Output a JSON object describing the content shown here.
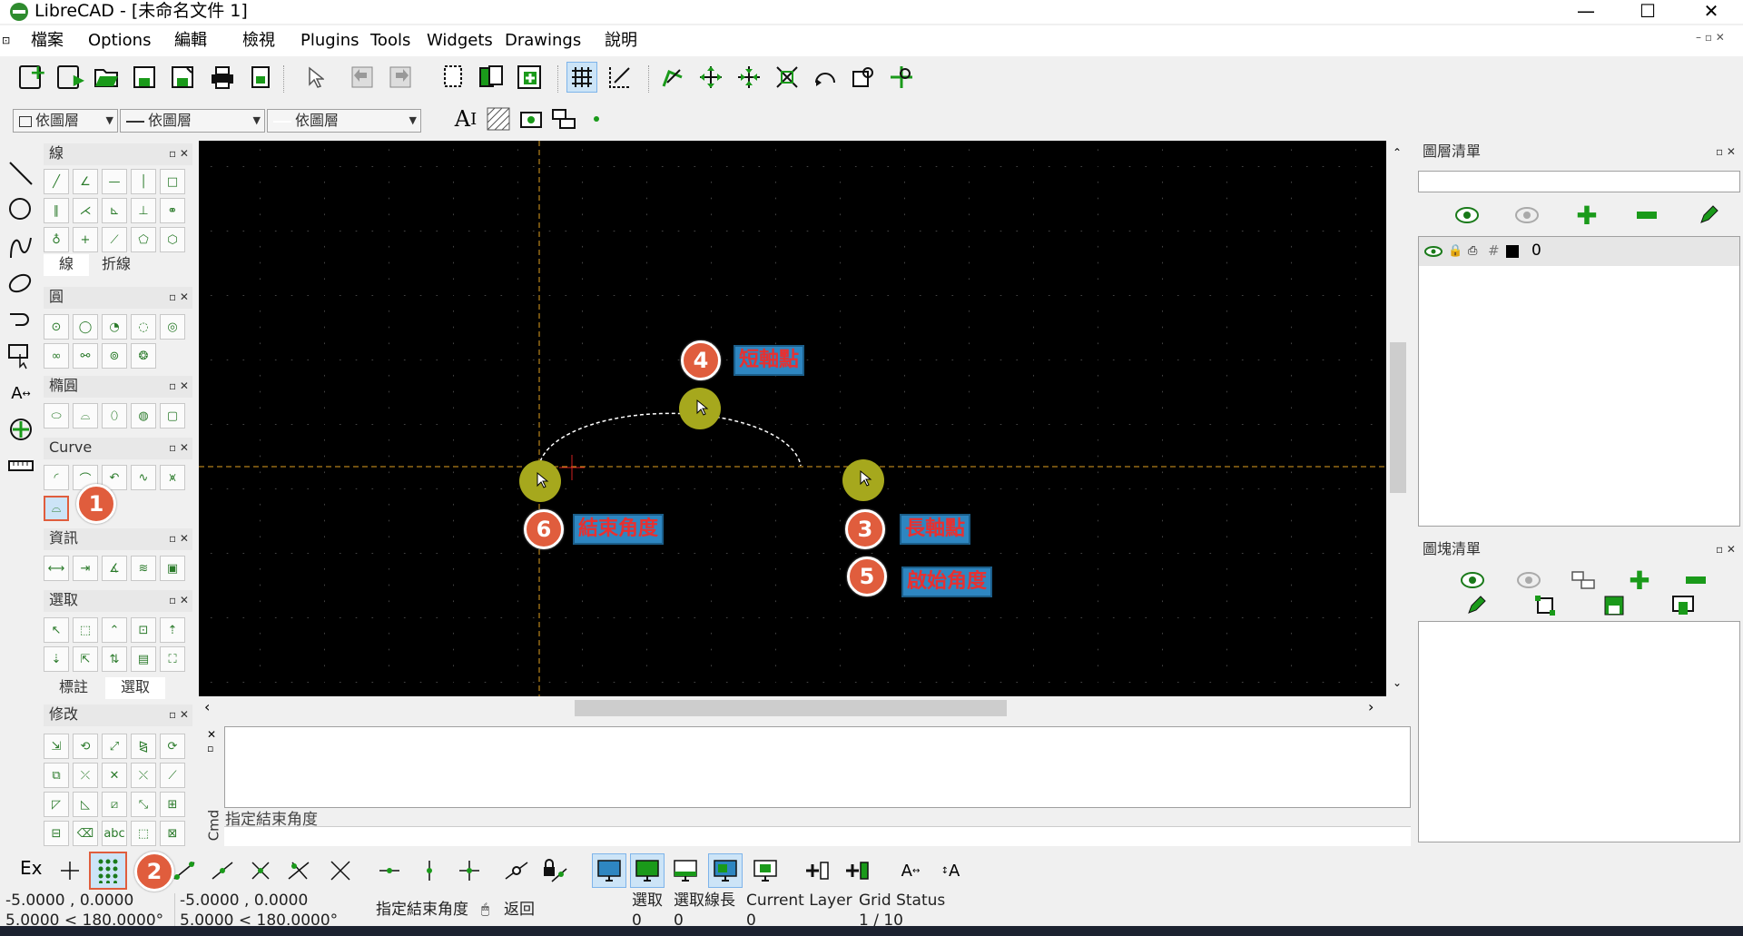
{
  "window": {
    "title": "LibreCAD - [未命名文件 1]",
    "minimize": "—",
    "maximize": "☐",
    "close": "✕"
  },
  "menu": [
    "檔案",
    "Options",
    "編輯",
    "檢視",
    "Plugins",
    "Tools",
    "Widgets",
    "Drawings",
    "說明"
  ],
  "layer_combos": [
    "依圖層",
    "依圖層",
    "依圖層"
  ],
  "docks": {
    "line": {
      "title": "線",
      "tabs": [
        "線",
        "折線"
      ]
    },
    "circle": {
      "title": "圓"
    },
    "ellipse": {
      "title": "橢圓"
    },
    "curve": {
      "title": "Curve"
    },
    "info": {
      "title": "資訊"
    },
    "select": {
      "title": "選取",
      "tabs": [
        "標註",
        "選取"
      ]
    },
    "modify": {
      "title": "修改"
    }
  },
  "layer_panel": {
    "title": "圖層清單",
    "search_placeholder": "",
    "layers": [
      {
        "name": "0",
        "color": "#000000"
      }
    ]
  },
  "block_panel": {
    "title": "圖塊清單"
  },
  "annotations": [
    {
      "n": "4",
      "label": "短軸點"
    },
    {
      "n": "3",
      "label": "長軸點"
    },
    {
      "n": "5",
      "label": "啟始角度"
    },
    {
      "n": "6",
      "label": "結束角度"
    },
    {
      "n": "1",
      "label": ""
    },
    {
      "n": "2",
      "label": ""
    }
  ],
  "command": {
    "side_label": "Cmd",
    "prompt": "指定結束角度"
  },
  "snap_bar": {
    "ex": "Ex"
  },
  "status": {
    "abs_coord": "-5.0000 , 0.0000",
    "abs_polar": "5.0000 < 180.0000°",
    "rel_coord": "-5.0000 , 0.0000",
    "rel_polar": "5.0000 < 180.0000°",
    "prompt": "指定結束角度",
    "back": "返回",
    "selected_label": "選取",
    "selected_value": "0",
    "sel_length_label": "選取線長",
    "sel_length_value": "0",
    "current_layer_label": "Current Layer",
    "current_layer_value": "0",
    "grid_status_label": "Grid Status",
    "grid_status_value": "1 / 10"
  },
  "colors": {
    "accent_marker": "#a6a81d",
    "badge": "#e05d3d",
    "label_bg": "#2e86c1",
    "label_text": "#e83030",
    "guide": "#e0a020"
  }
}
